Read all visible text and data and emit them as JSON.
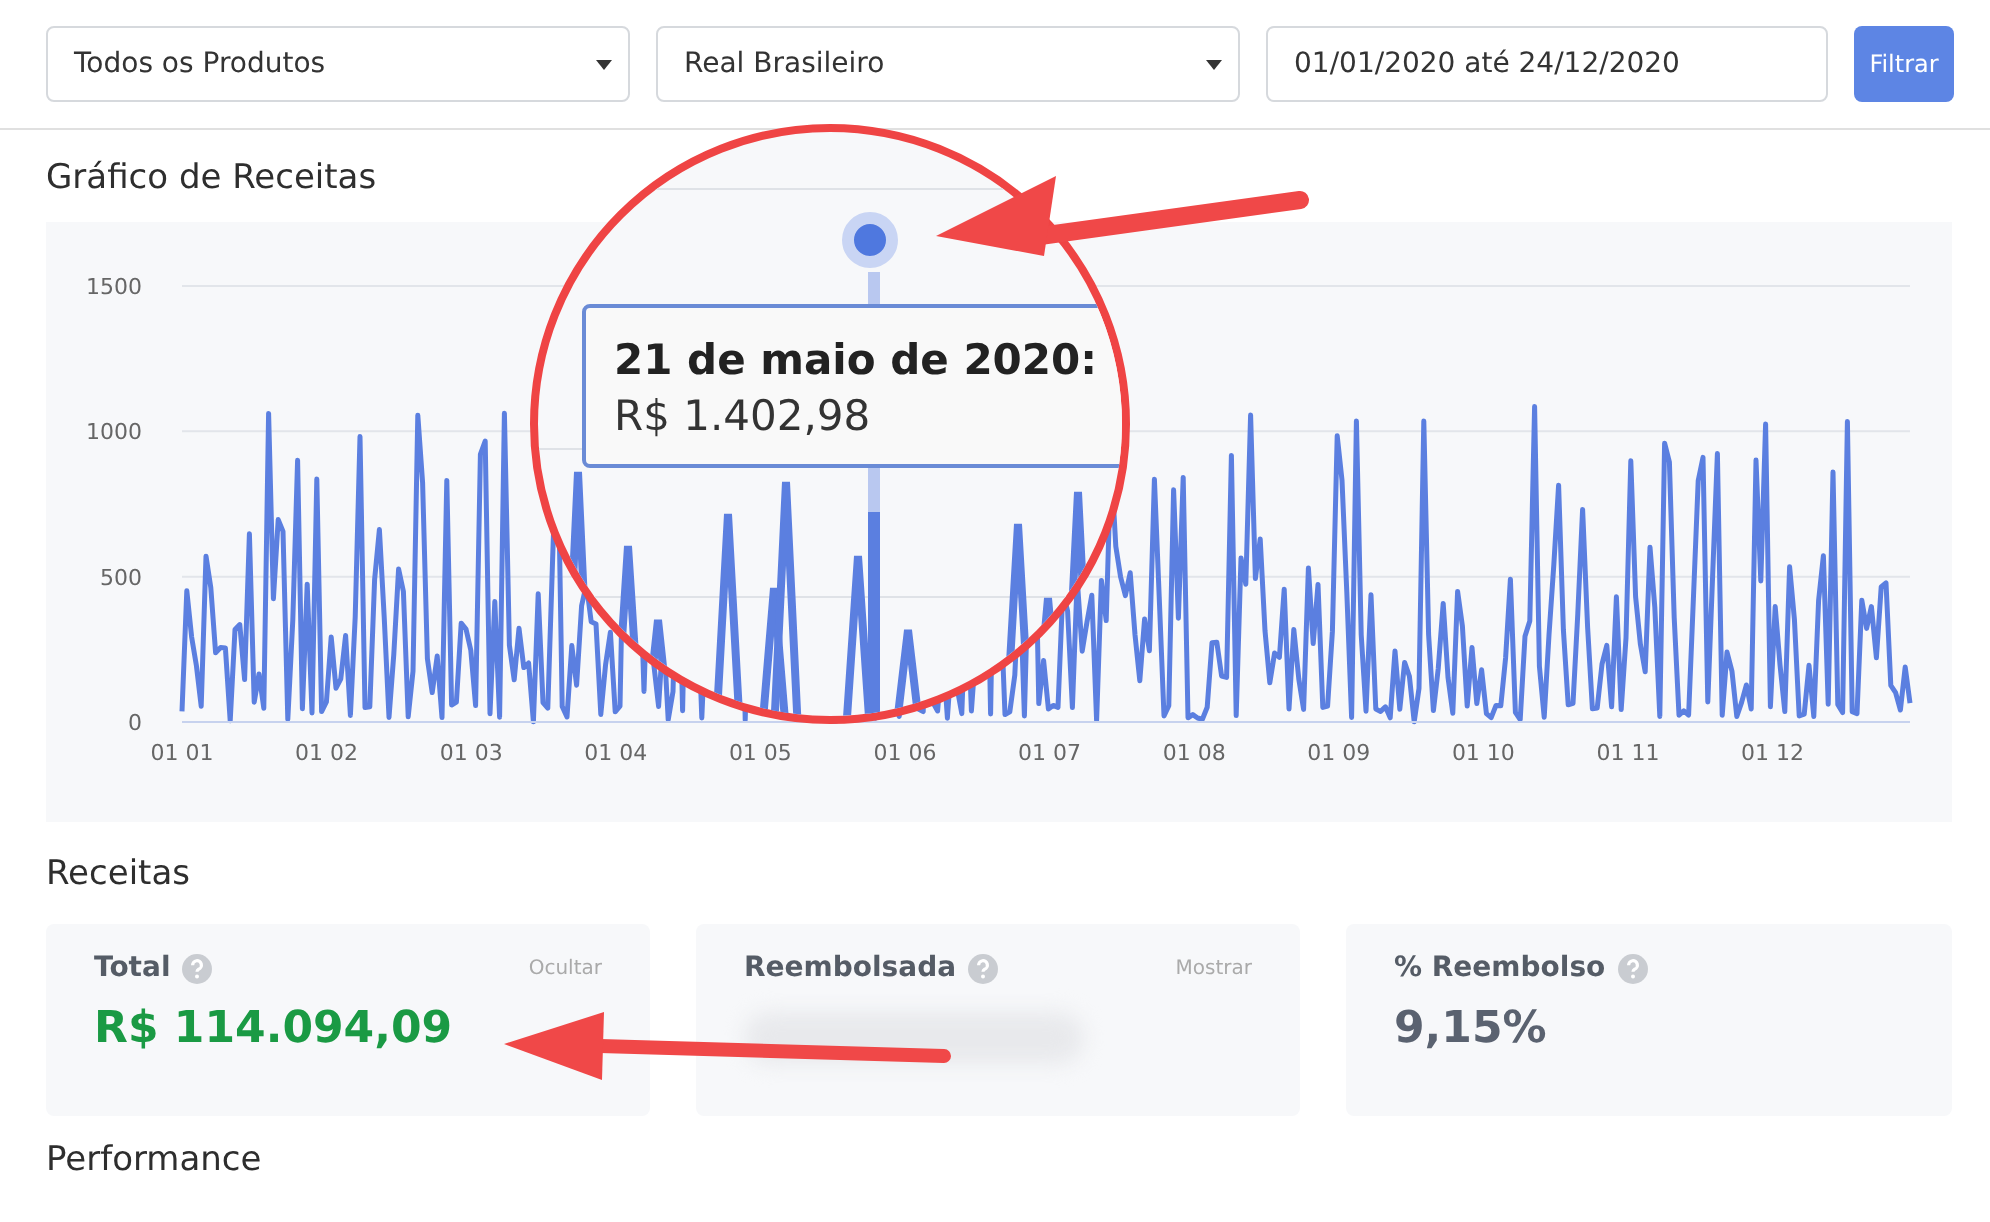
{
  "filters": {
    "product": "Todos os Produtos",
    "currency": "Real Brasileiro",
    "date_range": "01/01/2020 até 24/12/2020",
    "button": "Filtrar"
  },
  "revenue_chart": {
    "title": "Gráfico de Receitas",
    "y_labels": [
      "1500",
      "1000",
      "500",
      "0"
    ],
    "x_labels": [
      "01 01",
      "01 02",
      "01 03",
      "01 04",
      "01 05",
      "01 06",
      "01 07",
      "01 08",
      "01 09",
      "01 10",
      "01 11",
      "01 12"
    ],
    "tooltip": {
      "date": "21 de maio de 2020:",
      "value": "R$ 1.402,98"
    }
  },
  "revenue": {
    "title": "Receitas",
    "cards": [
      {
        "label": "Total",
        "action": "Ocultar",
        "value": "R$ 114.094,09",
        "hidden": false,
        "color": "#1a9a44"
      },
      {
        "label": "Reembolsada",
        "action": "Mostrar",
        "hidden": true
      },
      {
        "label": "% Reembolso",
        "value": "9,15%",
        "hidden": false,
        "color": "#5a6270"
      }
    ]
  },
  "performance": {
    "title": "Performance"
  }
}
